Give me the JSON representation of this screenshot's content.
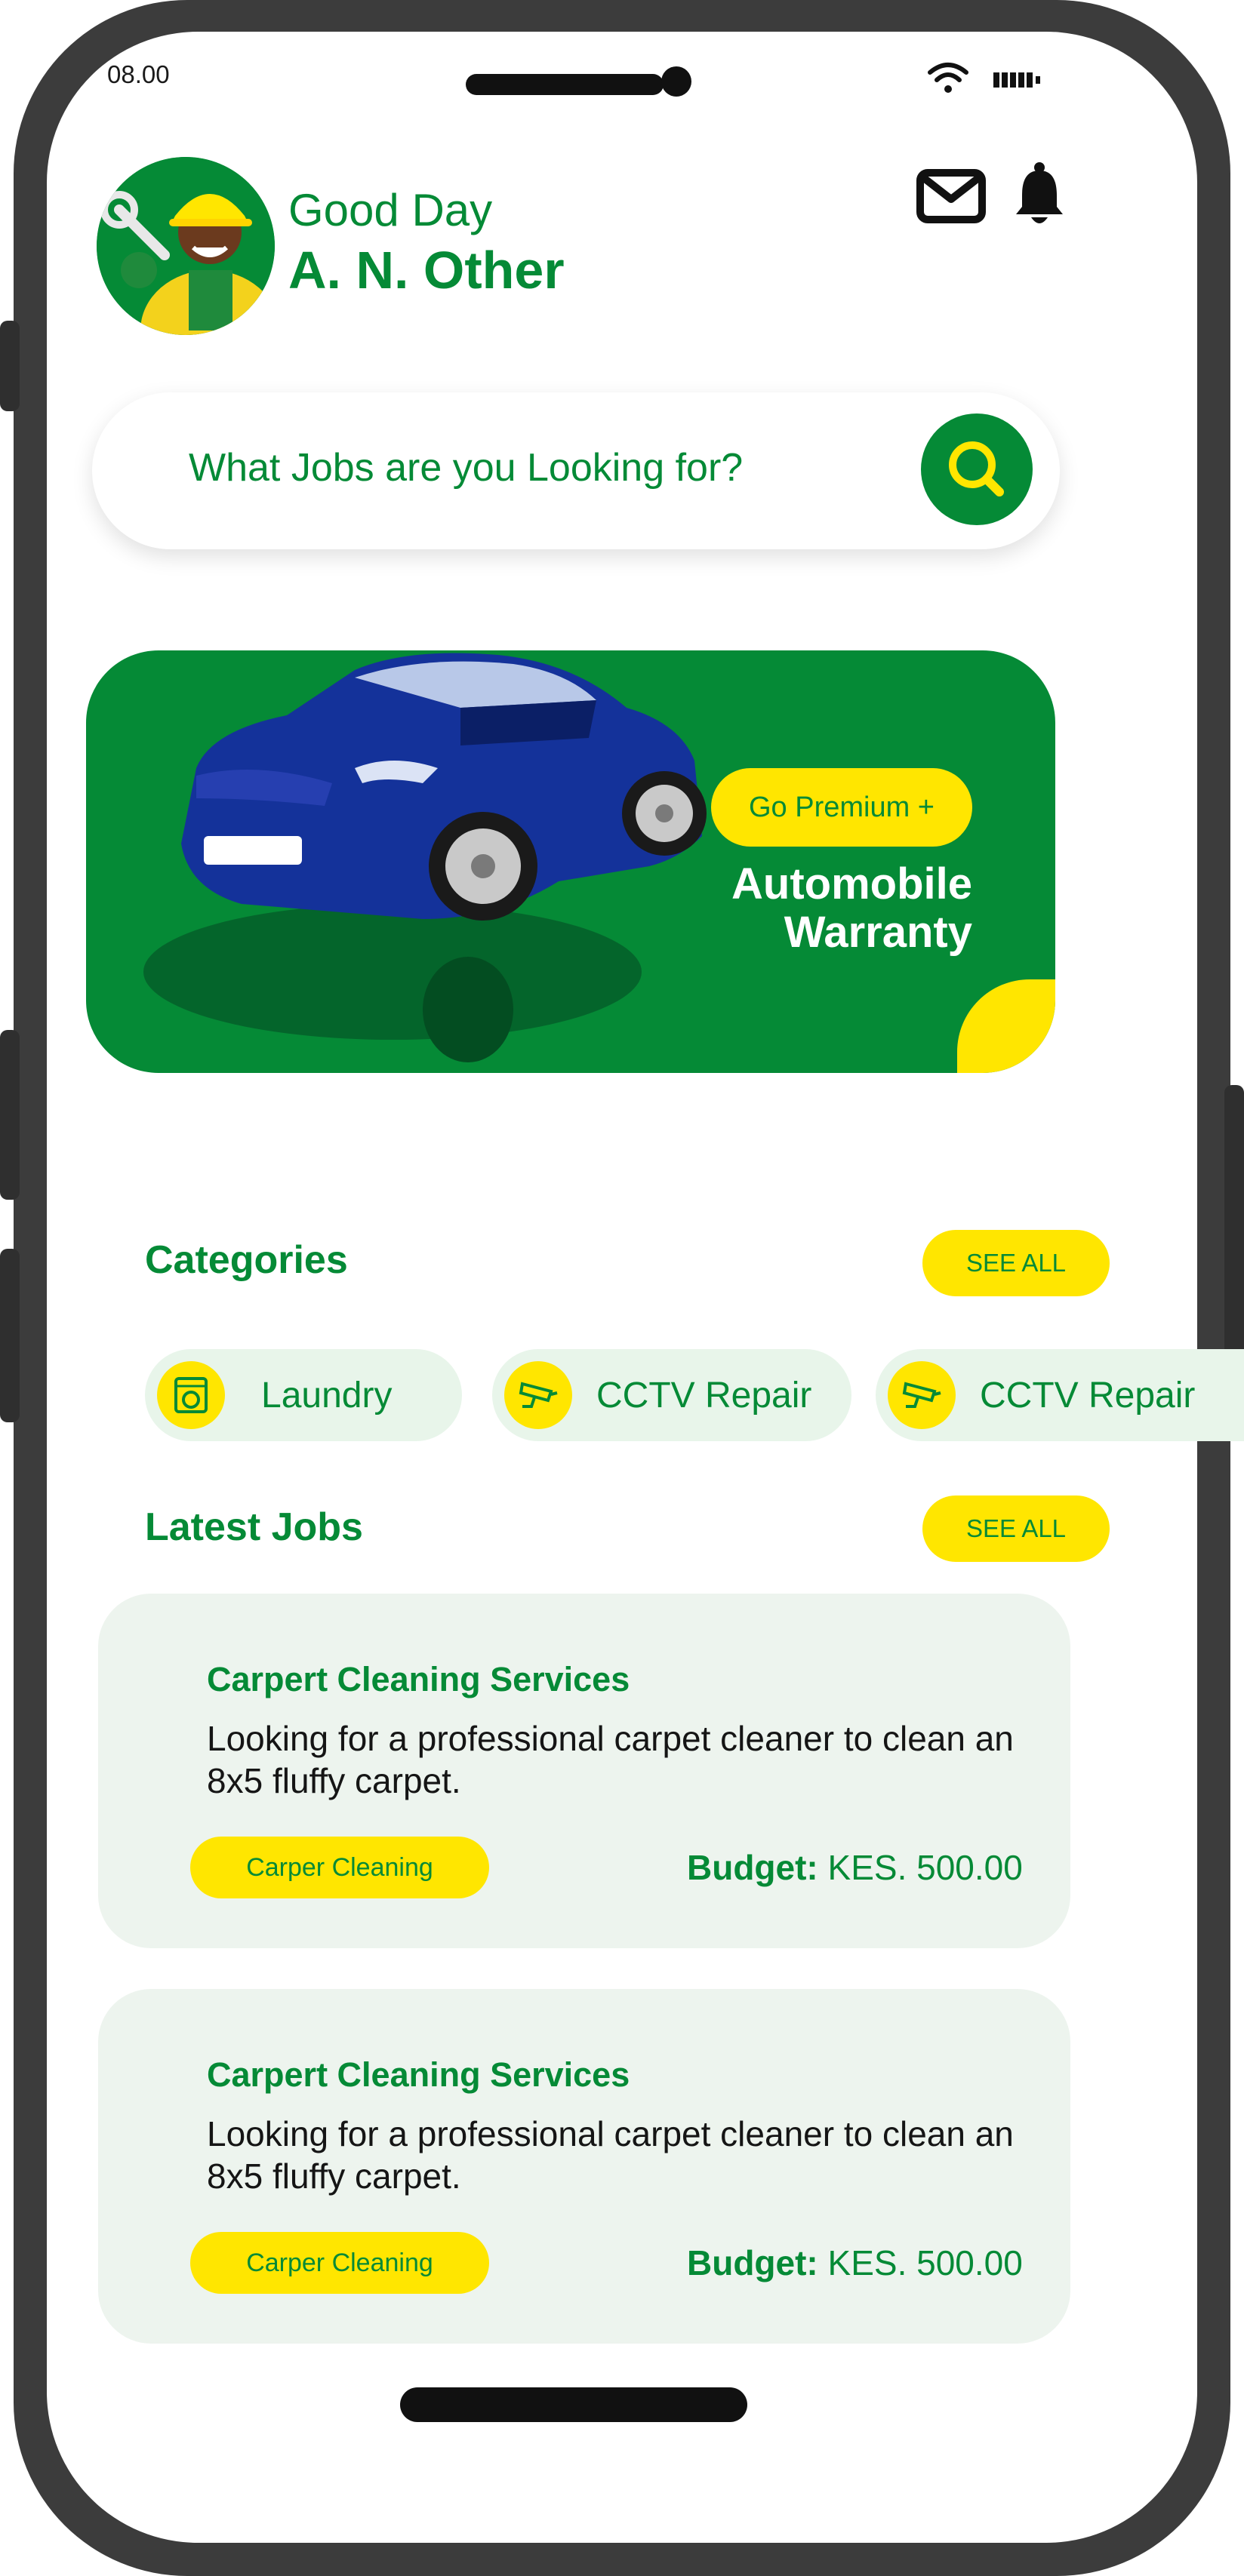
{
  "status": {
    "time": "08.00"
  },
  "header": {
    "greeting": "Good Day",
    "name": "A. N. Other",
    "icons": [
      "mail-icon",
      "bell-icon"
    ]
  },
  "search": {
    "placeholder": "What Jobs are you Looking for?"
  },
  "banner": {
    "button_label": "Go Premium +",
    "title_line1": "Automobile",
    "title_line2": "Warranty"
  },
  "categories": {
    "title": "Categories",
    "see_all": "SEE ALL",
    "items": [
      {
        "label": "Laundry",
        "icon": "washing-machine-icon"
      },
      {
        "label": "CCTV Repair",
        "icon": "cctv-camera-icon"
      },
      {
        "label": "CCTV Repair",
        "icon": "cctv-camera-icon"
      }
    ]
  },
  "latest_jobs": {
    "title": "Latest Jobs",
    "see_all": "SEE ALL",
    "jobs": [
      {
        "title": "Carpert Cleaning Services",
        "description": "Looking for a professional carpet cleaner to clean an 8x5 fluffy carpet.",
        "tag": "Carper Cleaning",
        "budget_label": "Budget:",
        "budget_value": "KES. 500.00"
      },
      {
        "title": "Carpert Cleaning Services",
        "description": "Looking for a professional carpet cleaner to clean an 8x5 fluffy carpet.",
        "tag": "Carper Cleaning",
        "budget_label": "Budget:",
        "budget_value": "KES. 500.00"
      }
    ]
  },
  "colors": {
    "brand_green": "#058a36",
    "accent_yellow": "#ffe600",
    "card_background": "#edf4ee"
  }
}
